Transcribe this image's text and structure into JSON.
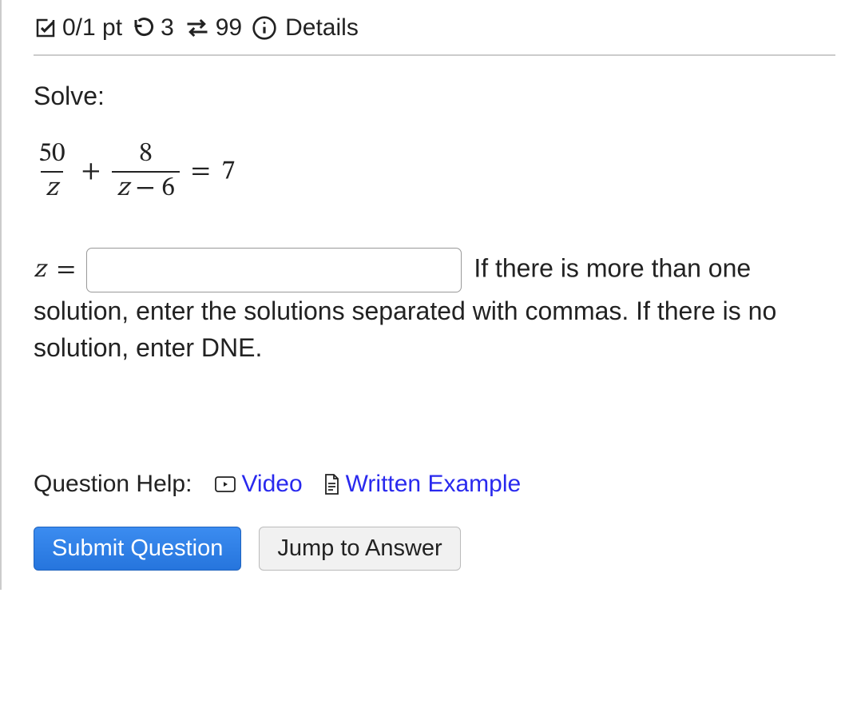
{
  "header": {
    "score": "0/1 pt",
    "retries": "3",
    "reattempts": "99",
    "details_label": "Details"
  },
  "question": {
    "prompt": "Solve:",
    "frac1_num": "50",
    "frac1_den": "z",
    "plus": "+",
    "frac2_num": "8",
    "frac2_den": "z − 6",
    "equals": "=",
    "rhs": "7",
    "answer_var": "z",
    "answer_eq": "=",
    "hint_part1": " If there is more than one solution, enter the solutions separated with commas. If there is no solution, enter DNE."
  },
  "help": {
    "label": "Question Help:",
    "video": "Video",
    "written": "Written Example"
  },
  "buttons": {
    "submit": "Submit Question",
    "jump": "Jump to Answer"
  }
}
